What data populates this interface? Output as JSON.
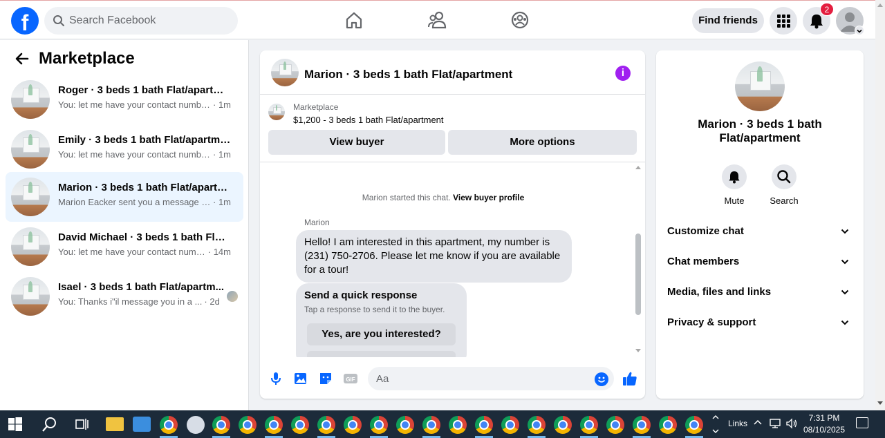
{
  "header": {
    "search_placeholder": "Search Facebook",
    "find_friends": "Find friends",
    "notification_count": "2"
  },
  "sidebar": {
    "title": "Marketplace",
    "conversations": [
      {
        "name": "Roger · 3 beds 1 bath Flat/apartme...",
        "snippet": "You: let me have your contact numbe...",
        "time": "· 1m",
        "active": false
      },
      {
        "name": "Emily · 3 beds 1 bath Flat/apartment",
        "snippet": "You: let me have your contact numbe...",
        "time": "· 1m",
        "active": false
      },
      {
        "name": "Marion · 3 beds 1 bath Flat/apartm...",
        "snippet": "Marion Eacker sent you a message a...",
        "time": "· 1m",
        "active": true
      },
      {
        "name": "David Michael · 3 beds 1 bath Flat/...",
        "snippet": "You: let me have your contact numb...",
        "time": "· 14m",
        "active": false
      },
      {
        "name": "Isael · 3 beds 1 bath Flat/apartm...",
        "snippet": "You: Thanks i\"il message you in a ...",
        "time": "· 2d",
        "active": false
      }
    ]
  },
  "chat": {
    "title": "Marion · 3 beds 1 bath Flat/apartment",
    "listing_source": "Marketplace",
    "listing_price": "$1,200 - 3 beds 1 bath Flat/apartment",
    "view_buyer": "View buyer",
    "more_options": "More options",
    "system_note": "Marion started this chat.",
    "system_link": "View buyer profile",
    "sender": "Marion",
    "message": "Hello! I am interested in this apartment, my number is (231) 750-2706. Please let me know if you are available for a tour!",
    "quick_response_title": "Send a quick response",
    "quick_response_sub": "Tap a response to send it to the buyer.",
    "quick_response_option": "Yes, are you interested?",
    "composer_placeholder": "Aa"
  },
  "details": {
    "name": "Marion · 3 beds 1 bath Flat/apartment",
    "mute": "Mute",
    "search": "Search",
    "sections": [
      "Customize chat",
      "Chat members",
      "Media, files and links",
      "Privacy & support"
    ]
  },
  "taskbar": {
    "links": "Links",
    "time": "7:31 PM",
    "date": "08/10/2025"
  },
  "colors": {
    "facebook_blue": "#0866ff",
    "active_conversation": "#ebf5ff",
    "info_icon": "#a020f0",
    "badge_red": "#e41e3f"
  }
}
